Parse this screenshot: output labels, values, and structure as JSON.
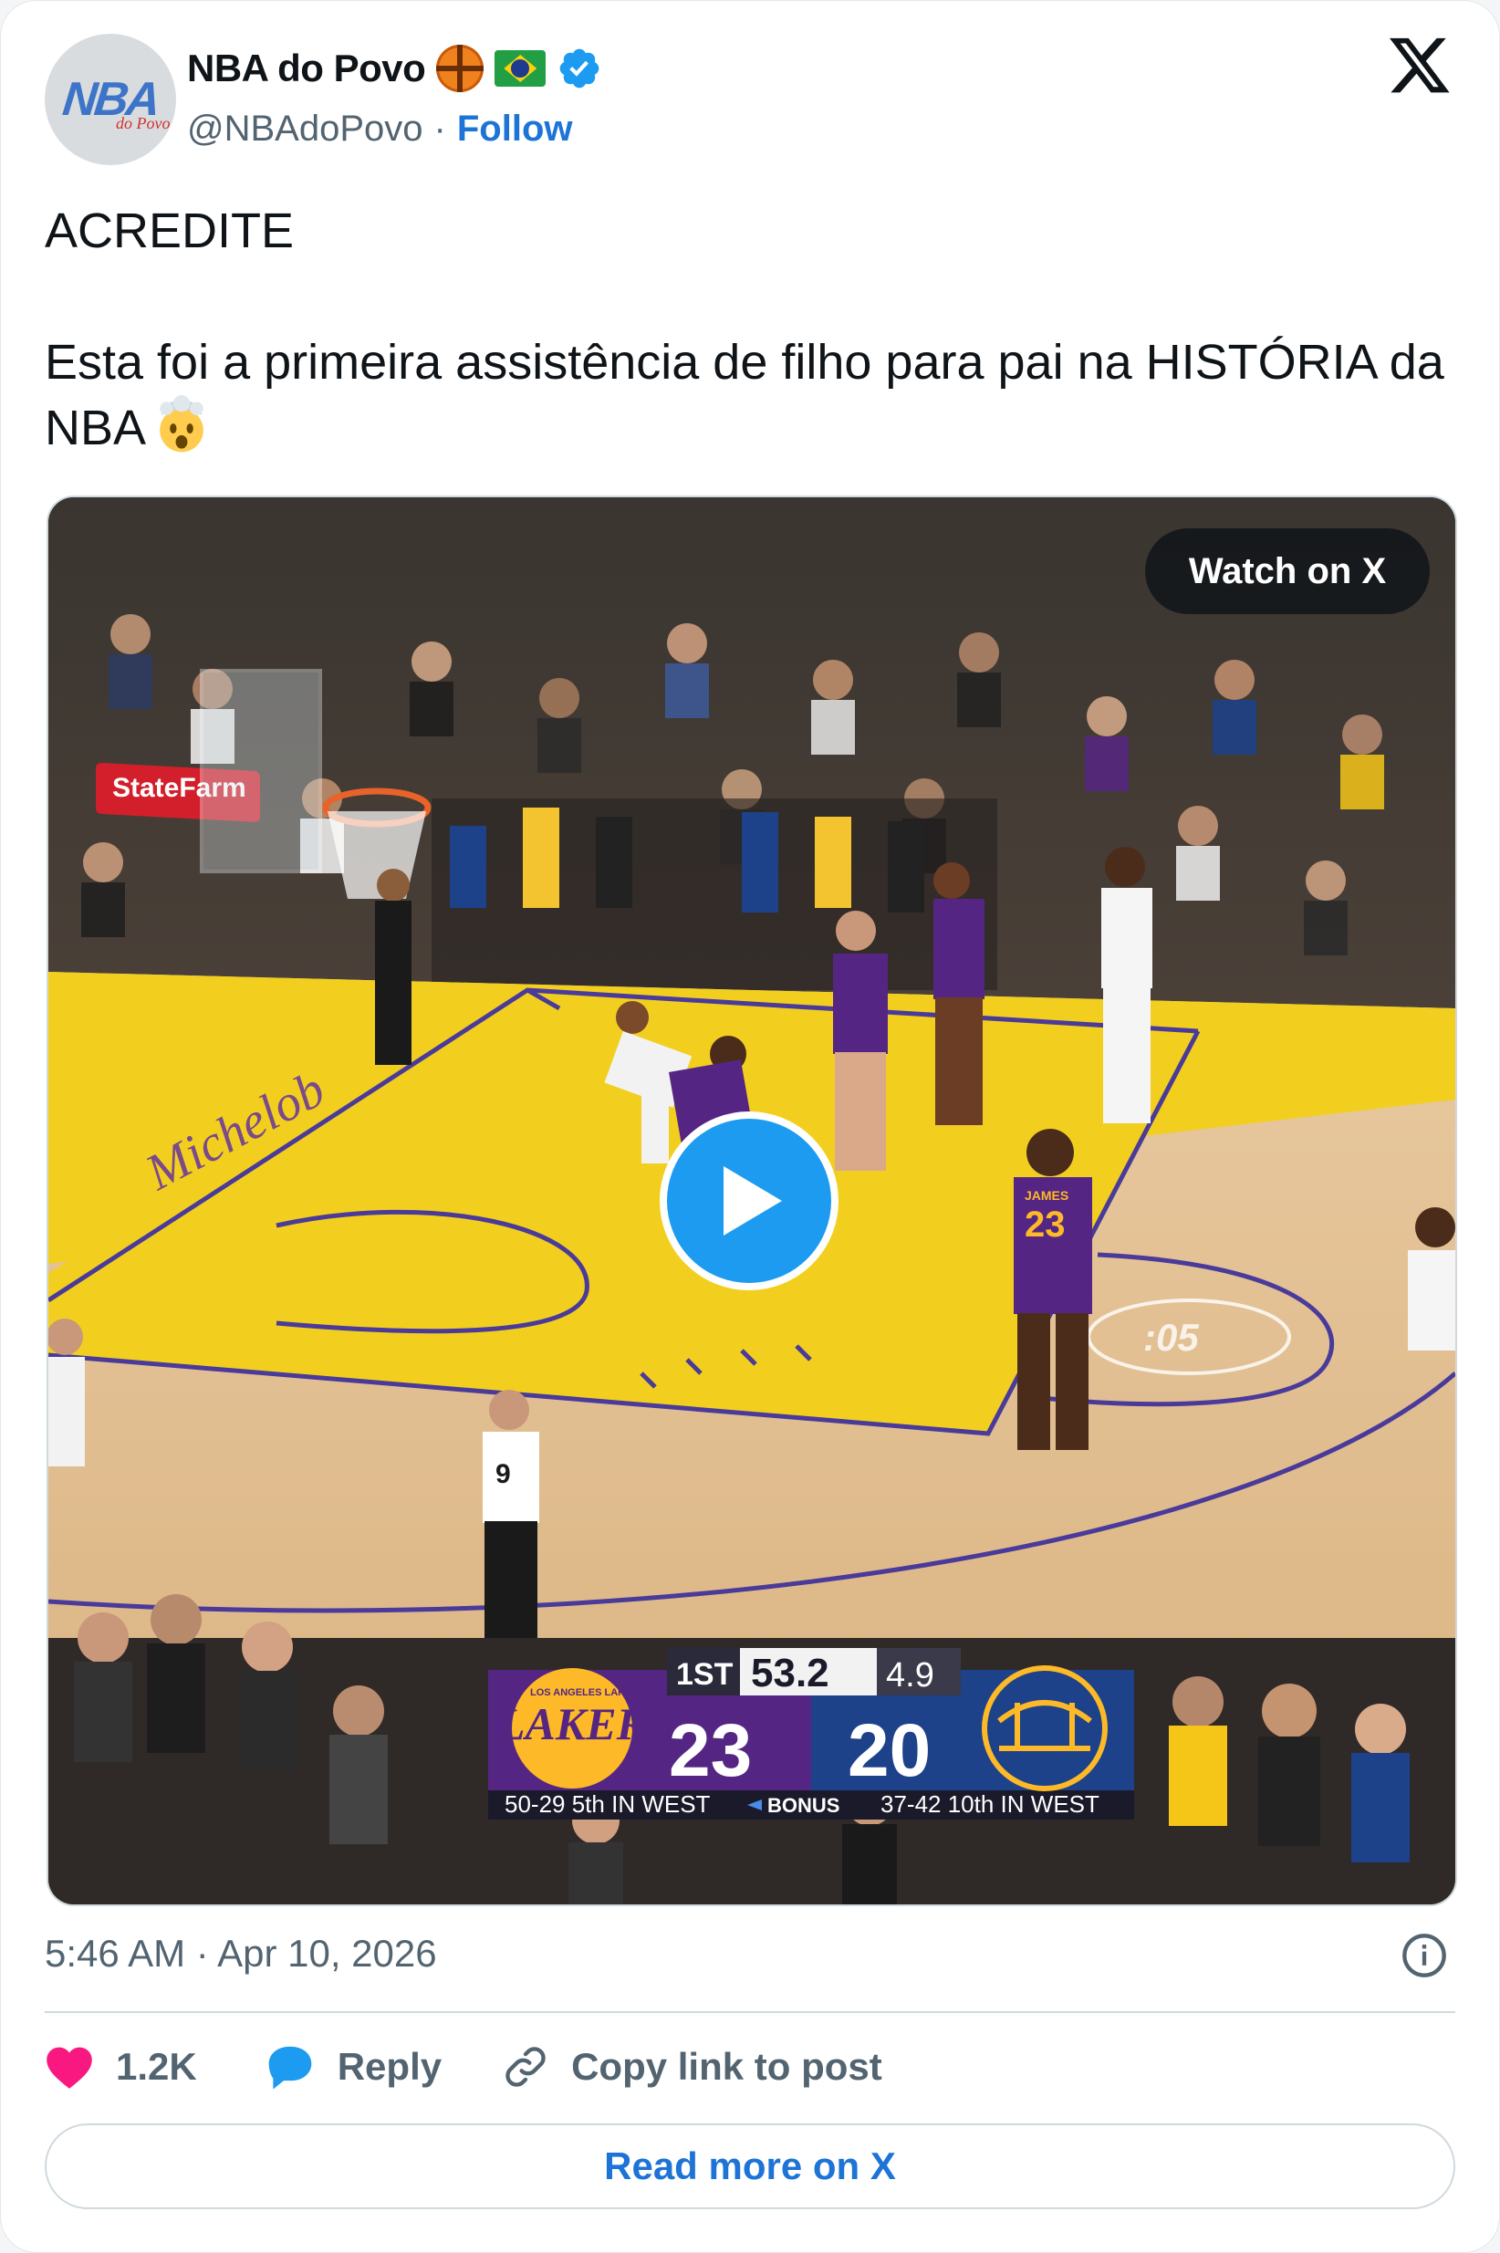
{
  "author": {
    "display_name": "NBA do Povo",
    "handle": "@NBAdoPovo",
    "separator": "·",
    "follow_label": "Follow",
    "avatar_text": "NBA",
    "avatar_subtext": "do Povo",
    "name_emojis": [
      "basketball-emoji",
      "brazil-flag-emoji"
    ],
    "verified": true
  },
  "tweet": {
    "line1": "ACREDITE",
    "line2": "Esta foi a primeira assistência de filho para pai na HISTÓRIA da NBA",
    "trailing_emoji": "exploding-head-emoji"
  },
  "media": {
    "watch_label": "Watch on X",
    "sponsor_sign": "StateFarm",
    "court_text": "Michelob",
    "shot_clock_floor": ":05",
    "scorebug": {
      "period": "1ST",
      "game_clock": "53.2",
      "shot_clock": "4.9",
      "home_team": "LAKERS",
      "home_team_full": "LOS ANGELES LAKERS",
      "home_score": "23",
      "away_score": "20",
      "home_record": "50-29 5th IN WEST",
      "bonus_label": "BONUS",
      "away_record": "37-42 10th IN WEST"
    },
    "jersey_numbers": [
      "23",
      "9"
    ],
    "jersey_name": "JAMES"
  },
  "timestamp": "5:46 AM · Apr 10, 2026",
  "actions": {
    "likes": "1.2K",
    "reply_label": "Reply",
    "copy_label": "Copy link to post"
  },
  "read_more_label": "Read more on X",
  "colors": {
    "like": "#f91880",
    "link": "#1d74d6",
    "play": "#1d9bf0",
    "lakers_purple": "#552583",
    "lakers_gold": "#fdb927",
    "warriors_blue": "#1d428a",
    "court_yellow": "#f2cf1f"
  }
}
